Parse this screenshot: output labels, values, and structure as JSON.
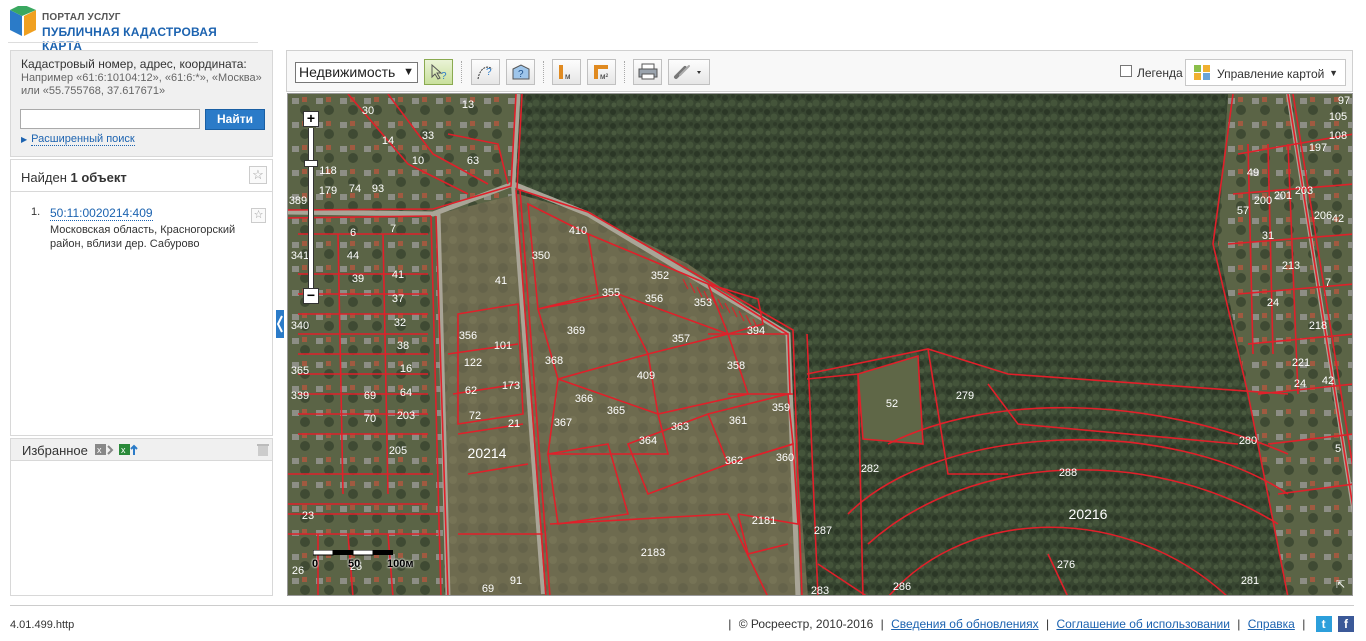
{
  "header": {
    "logo_line1": "ПОРТАЛ УСЛУГ",
    "logo_line2": "ПУБЛИЧНАЯ КАДАСТРОВАЯ КАРТА"
  },
  "search": {
    "hint_title": "Кадастровый номер, адрес, координата:",
    "hint_examples": "Например «61:6:10104:12», «61:6:*», «Москва» или «55.755768, 37.617671»",
    "input_value": "",
    "button_label": "Найти",
    "advanced_label": "Расширенный поиск"
  },
  "results": {
    "found_prefix": "Найден ",
    "found_count": "1 объект",
    "items": [
      {
        "num": "1.",
        "cadastral_number": "50:11:0020214:409",
        "address": "Московская область, Красногорский район, вблизи дер. Сабурово"
      }
    ]
  },
  "favorites": {
    "title": "Избранное"
  },
  "toolbar": {
    "layer_select": "Недвижимость",
    "legend_label": "Легенда",
    "legend_checked": false,
    "map_control_label": "Управление картой",
    "tools": [
      "select-info-tool",
      "curve-measure-tool",
      "area-info-tool",
      "measure-length-tool",
      "measure-area-tool",
      "print-tool",
      "link-tool"
    ]
  },
  "map": {
    "scale_labels": [
      "0",
      "50",
      "100м"
    ],
    "block_labels": [
      "20214",
      "20216"
    ],
    "parcel_labels": [
      "13",
      "63",
      "30",
      "14",
      "33",
      "10",
      "118",
      "179",
      "74",
      "93",
      "389",
      "6",
      "7",
      "44",
      "39",
      "41",
      "37",
      "32",
      "38",
      "16",
      "64",
      "69",
      "70",
      "203",
      "205",
      "340",
      "365",
      "339",
      "341",
      "41",
      "410",
      "350",
      "352",
      "353",
      "355",
      "356",
      "357",
      "394",
      "369",
      "368",
      "409",
      "358",
      "366",
      "365",
      "367",
      "364",
      "363",
      "361",
      "359",
      "362",
      "360",
      "356",
      "122",
      "101",
      "173",
      "21",
      "62",
      "72",
      "52",
      "279",
      "282",
      "280",
      "288",
      "2181",
      "2183",
      "287",
      "286",
      "283",
      "276",
      "281",
      "105",
      "97",
      "108",
      "197",
      "49",
      "203",
      "57",
      "200",
      "201",
      "206",
      "31",
      "42",
      "213",
      "24",
      "7",
      "218",
      "221",
      "24",
      "42",
      "5",
      "91",
      "69",
      "25",
      "26",
      "23"
    ]
  },
  "footer": {
    "version": "4.01.499.http",
    "copyright": "© Росреестр, 2010-2016",
    "link_updates": "Сведения об обновлениях",
    "link_agreement": "Соглашение об использовании",
    "link_help": "Справка"
  },
  "colors": {
    "accent": "#2b7bc8",
    "link": "#1c63b0",
    "parcel_border": "#e0202a",
    "forest": "#3b4a32"
  }
}
